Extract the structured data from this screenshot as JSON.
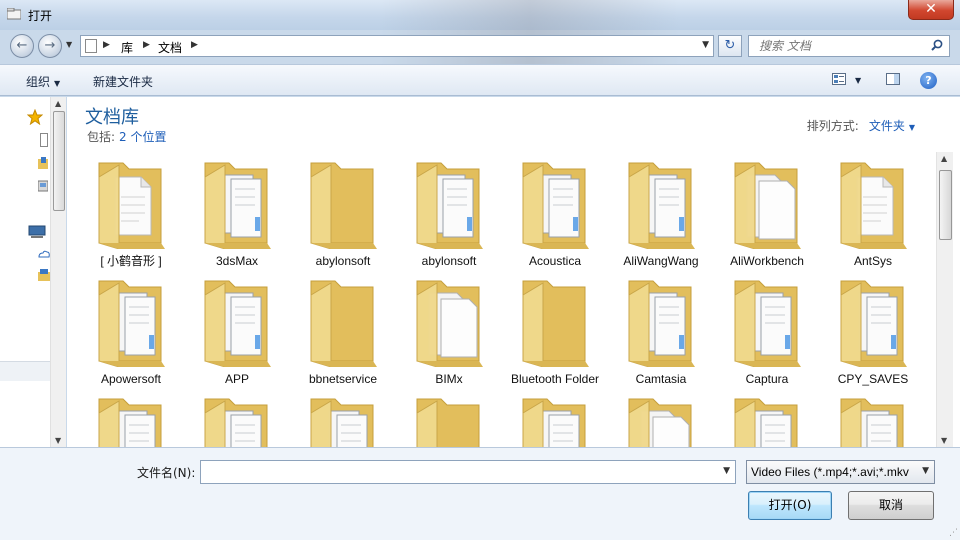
{
  "window": {
    "title": "打开",
    "close_glyph": "✕"
  },
  "address": {
    "crumbs": [
      "库",
      "文档"
    ],
    "back_glyph": "←",
    "forward_glyph": "→",
    "refresh_glyph": "↻",
    "search_placeholder": "搜索 文档"
  },
  "toolbar": {
    "organize_label": "组织",
    "new_folder_label": "新建文件夹",
    "help_label": "?"
  },
  "library": {
    "title": "文档库",
    "includes_label": "包括:",
    "includes_link": "2 个位置",
    "arrange_label": "排列方式:",
    "arrange_value": "文件夹"
  },
  "folders": [
    {
      "label": "[ 小鹤音形 ]",
      "kind": "doc"
    },
    {
      "label": "3dsMax",
      "kind": "files"
    },
    {
      "label": "abylonsoft",
      "kind": "empty"
    },
    {
      "label": "abylonsoft",
      "kind": "files"
    },
    {
      "label": "Acoustica",
      "kind": "files"
    },
    {
      "label": "AliWangWang",
      "kind": "files"
    },
    {
      "label": "AliWorkbench",
      "kind": "white"
    },
    {
      "label": "AntSys",
      "kind": "doc"
    },
    {
      "label": "Apowersoft",
      "kind": "files"
    },
    {
      "label": "APP",
      "kind": "files"
    },
    {
      "label": "bbnetservice",
      "kind": "empty"
    },
    {
      "label": "BIMx",
      "kind": "white"
    },
    {
      "label": "Bluetooth Folder",
      "kind": "empty"
    },
    {
      "label": "Camtasia",
      "kind": "files"
    },
    {
      "label": "Captura",
      "kind": "files"
    },
    {
      "label": "CPY_SAVES",
      "kind": "files"
    },
    {
      "label": "",
      "kind": "files"
    },
    {
      "label": "",
      "kind": "files"
    },
    {
      "label": "",
      "kind": "files"
    },
    {
      "label": "",
      "kind": "empty"
    },
    {
      "label": "",
      "kind": "files"
    },
    {
      "label": "",
      "kind": "white"
    },
    {
      "label": "",
      "kind": "files"
    },
    {
      "label": "",
      "kind": "files"
    }
  ],
  "bottom": {
    "filename_label": "文件名(N):",
    "filename_value": "",
    "filter_value": "Video Files (*.mp4;*.avi;*.mkv",
    "open_label": "打开(O)",
    "cancel_label": "取消"
  }
}
